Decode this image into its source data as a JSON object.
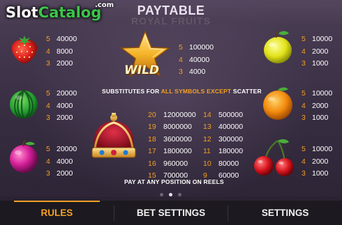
{
  "logo": {
    "slot": "Slot",
    "catalog": "Catalog",
    "com": ".com"
  },
  "page": {
    "title": "PAYTABLE"
  },
  "background": {
    "ghost_title": "ROYAL FRUITS"
  },
  "symbols": {
    "strawberry": {
      "pays": [
        {
          "count": "5",
          "value": "40000"
        },
        {
          "count": "4",
          "value": "8000"
        },
        {
          "count": "3",
          "value": "2000"
        }
      ]
    },
    "watermelon": {
      "pays": [
        {
          "count": "5",
          "value": "20000"
        },
        {
          "count": "4",
          "value": "4000"
        },
        {
          "count": "3",
          "value": "2000"
        }
      ]
    },
    "plum": {
      "pays": [
        {
          "count": "5",
          "value": "20000"
        },
        {
          "count": "4",
          "value": "4000"
        },
        {
          "count": "3",
          "value": "2000"
        }
      ]
    },
    "lemon": {
      "pays": [
        {
          "count": "5",
          "value": "10000"
        },
        {
          "count": "4",
          "value": "2000"
        },
        {
          "count": "3",
          "value": "1000"
        }
      ]
    },
    "orange": {
      "pays": [
        {
          "count": "5",
          "value": "10000"
        },
        {
          "count": "4",
          "value": "2000"
        },
        {
          "count": "3",
          "value": "1000"
        }
      ]
    },
    "cherry": {
      "pays": [
        {
          "count": "5",
          "value": "10000"
        },
        {
          "count": "4",
          "value": "2000"
        },
        {
          "count": "3",
          "value": "1000"
        }
      ]
    },
    "wild": {
      "label": "WILD",
      "pays": [
        {
          "count": "5",
          "value": "100000"
        },
        {
          "count": "4",
          "value": "40000"
        },
        {
          "count": "3",
          "value": "4000"
        }
      ],
      "caption_prefix": "SUBSTITUTES FOR ",
      "caption_highlight": "ALL SYMBOLS EXCEPT",
      "caption_suffix": " SCATTER"
    },
    "scatter": {
      "rows": [
        {
          "c1": "20",
          "v1": "12000000",
          "c2": "14",
          "v2": "500000"
        },
        {
          "c1": "19",
          "v1": "8000000",
          "c2": "13",
          "v2": "400000"
        },
        {
          "c1": "18",
          "v1": "3600000",
          "c2": "12",
          "v2": "300000"
        },
        {
          "c1": "17",
          "v1": "1800000",
          "c2": "11",
          "v2": "180000"
        },
        {
          "c1": "16",
          "v1": "960000",
          "c2": "10",
          "v2": "80000"
        },
        {
          "c1": "15",
          "v1": "700000",
          "c2": "9",
          "v2": "60000"
        }
      ],
      "caption": "PAY AT ANY POSITION ON REELS"
    }
  },
  "pagination": {
    "pages": 3,
    "active": 1
  },
  "tabs": {
    "rules": "RULES",
    "bet_settings": "BET SETTINGS",
    "settings": "SETTINGS"
  },
  "colors": {
    "accent": "#f4a023",
    "brand_green": "#3cc44a",
    "bar": "#1c1a20"
  }
}
